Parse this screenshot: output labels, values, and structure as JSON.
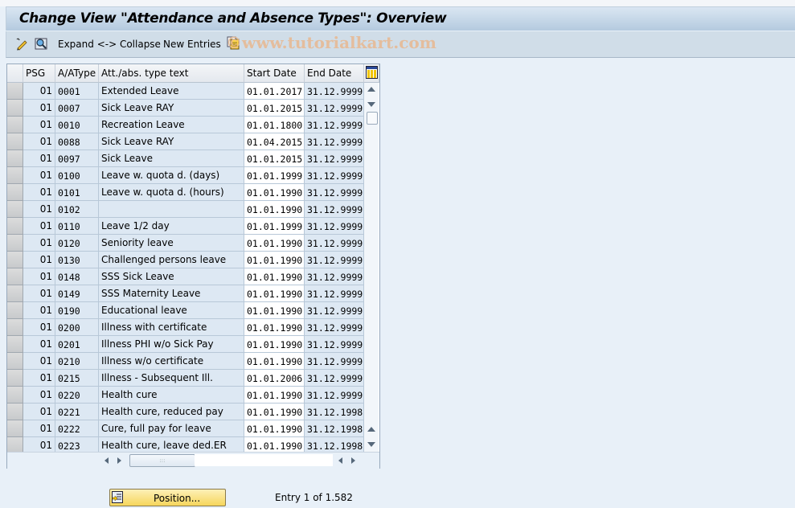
{
  "window": {
    "title": "Change View \"Attendance and Absence Types\": Overview"
  },
  "toolbar": {
    "expand_collapse_label": "Expand <-> Collapse",
    "new_entries_label": "New Entries",
    "watermark": "©www.tutorialkart.com"
  },
  "table": {
    "columns": [
      "PSG",
      "A/AType",
      "Att./abs. type text",
      "Start Date",
      "End Date"
    ],
    "rows": [
      {
        "psg": "01",
        "type": "0001",
        "text": "Extended Leave",
        "start": "01.01.2017",
        "end": "31.12.9999"
      },
      {
        "psg": "01",
        "type": "0007",
        "text": "Sick Leave RAY",
        "start": "01.01.2015",
        "end": "31.12.9999"
      },
      {
        "psg": "01",
        "type": "0010",
        "text": "Recreation Leave",
        "start": "01.01.1800",
        "end": "31.12.9999"
      },
      {
        "psg": "01",
        "type": "0088",
        "text": "Sick Leave RAY",
        "start": "01.04.2015",
        "end": "31.12.9999"
      },
      {
        "psg": "01",
        "type": "0097",
        "text": "Sick Leave",
        "start": "01.01.2015",
        "end": "31.12.9999"
      },
      {
        "psg": "01",
        "type": "0100",
        "text": "Leave w. quota d. (days)",
        "start": "01.01.1999",
        "end": "31.12.9999"
      },
      {
        "psg": "01",
        "type": "0101",
        "text": "Leave w. quota d. (hours)",
        "start": "01.01.1990",
        "end": "31.12.9999"
      },
      {
        "psg": "01",
        "type": "0102",
        "text": "",
        "start": "01.01.1990",
        "end": "31.12.9999"
      },
      {
        "psg": "01",
        "type": "0110",
        "text": "Leave 1/2 day",
        "start": "01.01.1999",
        "end": "31.12.9999"
      },
      {
        "psg": "01",
        "type": "0120",
        "text": "Seniority leave",
        "start": "01.01.1990",
        "end": "31.12.9999"
      },
      {
        "psg": "01",
        "type": "0130",
        "text": "Challenged persons leave",
        "start": "01.01.1990",
        "end": "31.12.9999"
      },
      {
        "psg": "01",
        "type": "0148",
        "text": "SSS Sick Leave",
        "start": "01.01.1990",
        "end": "31.12.9999"
      },
      {
        "psg": "01",
        "type": "0149",
        "text": "SSS Maternity Leave",
        "start": "01.01.1990",
        "end": "31.12.9999"
      },
      {
        "psg": "01",
        "type": "0190",
        "text": "Educational leave",
        "start": "01.01.1990",
        "end": "31.12.9999"
      },
      {
        "psg": "01",
        "type": "0200",
        "text": "Illness with certificate",
        "start": "01.01.1990",
        "end": "31.12.9999"
      },
      {
        "psg": "01",
        "type": "0201",
        "text": "Illness PHI w/o Sick Pay",
        "start": "01.01.1990",
        "end": "31.12.9999"
      },
      {
        "psg": "01",
        "type": "0210",
        "text": "Illness w/o certificate",
        "start": "01.01.1990",
        "end": "31.12.9999"
      },
      {
        "psg": "01",
        "type": "0215",
        "text": "Illness - Subsequent Ill.",
        "start": "01.01.2006",
        "end": "31.12.9999"
      },
      {
        "psg": "01",
        "type": "0220",
        "text": "Health cure",
        "start": "01.01.1990",
        "end": "31.12.9999"
      },
      {
        "psg": "01",
        "type": "0221",
        "text": "Health cure, reduced pay",
        "start": "01.01.1990",
        "end": "31.12.1998"
      },
      {
        "psg": "01",
        "type": "0222",
        "text": "Cure, full pay for leave",
        "start": "01.01.1990",
        "end": "31.12.1998"
      },
      {
        "psg": "01",
        "type": "0223",
        "text": "Health cure, leave ded.ER",
        "start": "01.01.1990",
        "end": "31.12.1998"
      }
    ]
  },
  "footer": {
    "position_label": "Position...",
    "entry_text": "Entry 1 of 1.582"
  },
  "icons": {
    "toolbar": [
      "edit-pencil-icon",
      "display-magnifier-icon",
      "copy-entries-icon"
    ],
    "table_settings": "column-settings-icon",
    "position": "position-cursor-icon"
  }
}
